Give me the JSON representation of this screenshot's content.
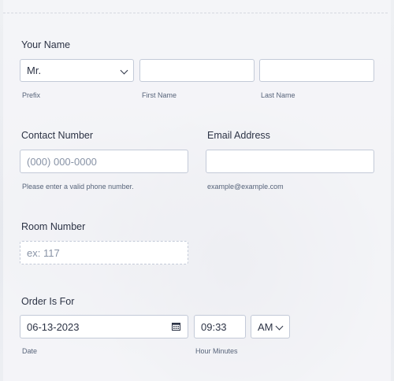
{
  "name": {
    "label": "Your Name",
    "prefix": {
      "value": "Mr.",
      "sublabel": "Prefix"
    },
    "first": {
      "value": "",
      "sublabel": "First Name"
    },
    "last": {
      "value": "",
      "sublabel": "Last Name"
    }
  },
  "contact": {
    "label": "Contact Number",
    "placeholder": "(000) 000-0000",
    "hint": "Please enter a valid phone number."
  },
  "email": {
    "label": "Email Address",
    "value": "",
    "hint": "example@example.com"
  },
  "room": {
    "label": "Room Number",
    "placeholder": "ex: 117"
  },
  "order": {
    "label": "Order Is For",
    "date": {
      "value": "06-13-2023",
      "sublabel": "Date"
    },
    "time": {
      "value": "09:33",
      "sublabel": "Hour Minutes"
    },
    "ampm": {
      "value": "AM"
    }
  },
  "colors": {
    "text": "#2c3345",
    "border": "#c3cad8",
    "sublabel": "#57647a"
  },
  "icons": [
    "chevron-down-icon",
    "calendar-icon"
  ]
}
